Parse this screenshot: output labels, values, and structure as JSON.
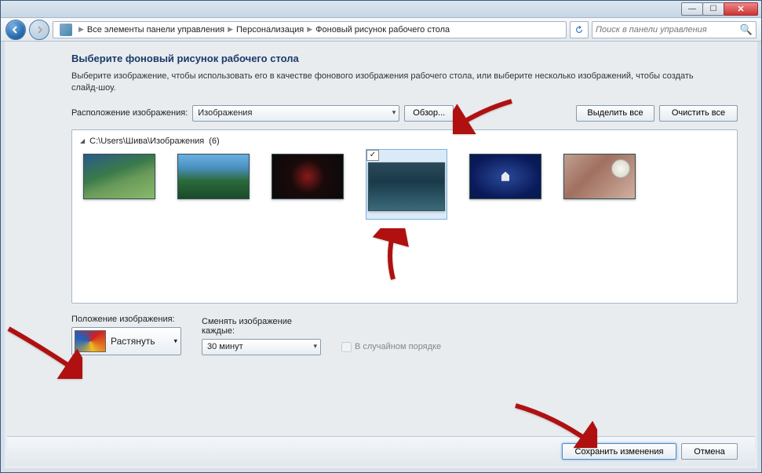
{
  "breadcrumb": {
    "item1": "Все элементы панели управления",
    "item2": "Персонализация",
    "item3": "Фоновый рисунок рабочего стола"
  },
  "search": {
    "placeholder": "Поиск в панели управления"
  },
  "heading": "Выберите фоновый рисунок рабочего стола",
  "description": "Выберите изображение, чтобы использовать его в качестве фонового изображения рабочего стола, или выберите несколько изображений, чтобы создать слайд-шоу.",
  "labels": {
    "location": "Расположение изображения:",
    "browse": "Обзор...",
    "select_all": "Выделить все",
    "clear_all": "Очистить все",
    "position": "Положение изображения:",
    "change_every": "Сменять изображение каждые:",
    "shuffle": "В случайном порядке",
    "save": "Сохранить изменения",
    "cancel": "Отмена"
  },
  "combos": {
    "location_value": "Изображения",
    "position_value": "Растянуть",
    "freq_value": "30 минут"
  },
  "folder": {
    "path": "C:\\Users\\Шива\\Изображения",
    "count": "(6)"
  }
}
